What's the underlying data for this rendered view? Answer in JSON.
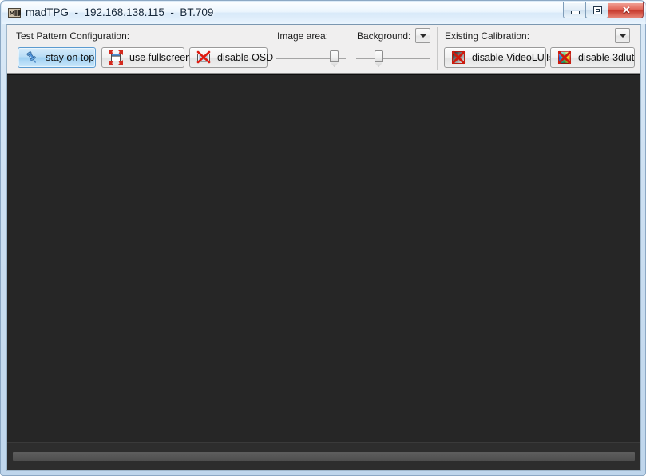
{
  "window": {
    "app_icon_name": "madtpg-app-icon",
    "title": "madTPG  -  192.168.138.115  -  BT.709",
    "app_name": "madTPG",
    "host": "192.168.138.115",
    "colorspace": "BT.709",
    "caption_buttons": [
      {
        "name": "minimize-button",
        "glyph": "minimize"
      },
      {
        "name": "maximize-button",
        "glyph": "maximize"
      },
      {
        "name": "close-button",
        "glyph": "✕"
      }
    ]
  },
  "toolbar": {
    "groups": [
      {
        "id": "test-pattern-configuration",
        "label": "Test Pattern Configuration:",
        "buttons": [
          {
            "id": "stay-on-top",
            "label": "stay on top",
            "icon": "pushpin-icon",
            "active": true
          },
          {
            "id": "use-fullscreen",
            "label": "use fullscreen",
            "icon": "fullscreen-icon",
            "active": false
          },
          {
            "id": "disable-osd",
            "label": "disable OSD",
            "icon": "osd-disabled-icon",
            "active": false
          }
        ]
      },
      {
        "id": "display-sliders",
        "sliders": [
          {
            "id": "image-area",
            "label": "Image area:",
            "value": 83
          },
          {
            "id": "background",
            "label": "Background:",
            "value": 30
          }
        ],
        "dropdown": {
          "id": "background-options-dropdown",
          "icon": "chevron-down-icon"
        }
      },
      {
        "id": "existing-calibration",
        "label": "Existing Calibration:",
        "dropdown": {
          "id": "calibration-options-dropdown",
          "icon": "chevron-down-icon"
        },
        "buttons": [
          {
            "id": "disable-videoluts",
            "label": "disable VideoLUTs",
            "icon": "videoluts-disabled-icon",
            "active": false
          },
          {
            "id": "disable-3dlut",
            "label": "disable 3dlut",
            "icon": "3dlut-disabled-icon",
            "active": false
          }
        ]
      }
    ]
  },
  "pattern_area": {
    "name": "test-pattern-surface",
    "patch_color": "#262626",
    "background_color": "#242424",
    "bottom_bar_color": "#565656"
  },
  "colors": {
    "frame": "#bfd6ec",
    "client_bg": "#f0f0f0",
    "toolbar_bg": "#f0efef",
    "accent_active": "#9ed0f2",
    "close_button": "#c6392c",
    "dark_area": "#262626"
  }
}
